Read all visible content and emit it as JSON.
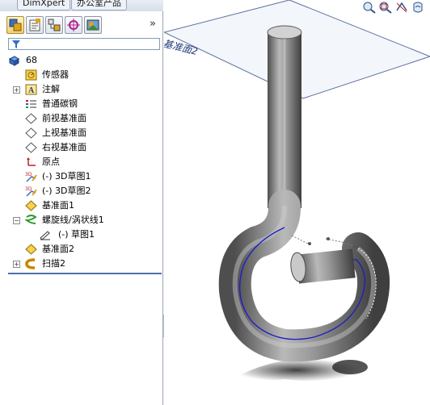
{
  "top_tabs": [
    "DimXpert",
    "办公室产品"
  ],
  "panel": {
    "icon_tabs": [
      {
        "name": "featuremanager-tab",
        "icon": "feature-tree-icon",
        "active": true
      },
      {
        "name": "propertymanager-tab",
        "icon": "property-manager-icon",
        "active": false
      },
      {
        "name": "configurationmanager-tab",
        "icon": "configuration-manager-icon",
        "active": false
      },
      {
        "name": "dimxpertmanager-tab",
        "icon": "dimxpert-manager-icon",
        "active": false
      },
      {
        "name": "displaymanager-tab",
        "icon": "display-manager-icon",
        "active": false
      }
    ],
    "expand_glyph": "»",
    "filter_icon": "filter-icon"
  },
  "tree": [
    {
      "label": "68",
      "icon": "part-icon",
      "indent": 0,
      "expand": ""
    },
    {
      "label": "传感器",
      "icon": "sensor-icon",
      "indent": 1,
      "expand": ""
    },
    {
      "label": "注解",
      "icon": "annotation-icon",
      "indent": 1,
      "expand": "+"
    },
    {
      "label": "普通碳钢",
      "icon": "material-icon",
      "indent": 1,
      "expand": ""
    },
    {
      "label": "前视基准面",
      "icon": "plane-icon",
      "indent": 1,
      "expand": ""
    },
    {
      "label": "上视基准面",
      "icon": "plane-icon",
      "indent": 1,
      "expand": ""
    },
    {
      "label": "右视基准面",
      "icon": "plane-icon",
      "indent": 1,
      "expand": ""
    },
    {
      "label": "原点",
      "icon": "origin-icon",
      "indent": 1,
      "expand": ""
    },
    {
      "label": "(-) 3D草图1",
      "icon": "3d-sketch-icon",
      "indent": 1,
      "expand": ""
    },
    {
      "label": "(-) 3D草图2",
      "icon": "3d-sketch-icon",
      "indent": 1,
      "expand": ""
    },
    {
      "label": "基准面1",
      "icon": "ref-plane-icon",
      "indent": 1,
      "expand": ""
    },
    {
      "label": "螺旋线/涡状线1",
      "icon": "helix-icon",
      "indent": 1,
      "expand": "−"
    },
    {
      "label": "(-) 草图1",
      "icon": "sketch-icon",
      "indent": 2,
      "expand": ""
    },
    {
      "label": "基准面2",
      "icon": "ref-plane-icon",
      "indent": 1,
      "expand": ""
    },
    {
      "label": "扫描2",
      "icon": "sweep-icon",
      "indent": 1,
      "expand": "+"
    }
  ],
  "viewport": {
    "plane_label": "基准面2",
    "view_tools": [
      "zoom-to-fit-icon",
      "zoom-area-icon",
      "previous-view-icon",
      "section-view-icon"
    ]
  },
  "colors": {
    "accent": "#4a6fb0",
    "part_gray": "#8a8a8a",
    "helix_blue": "#1c1cc8"
  }
}
